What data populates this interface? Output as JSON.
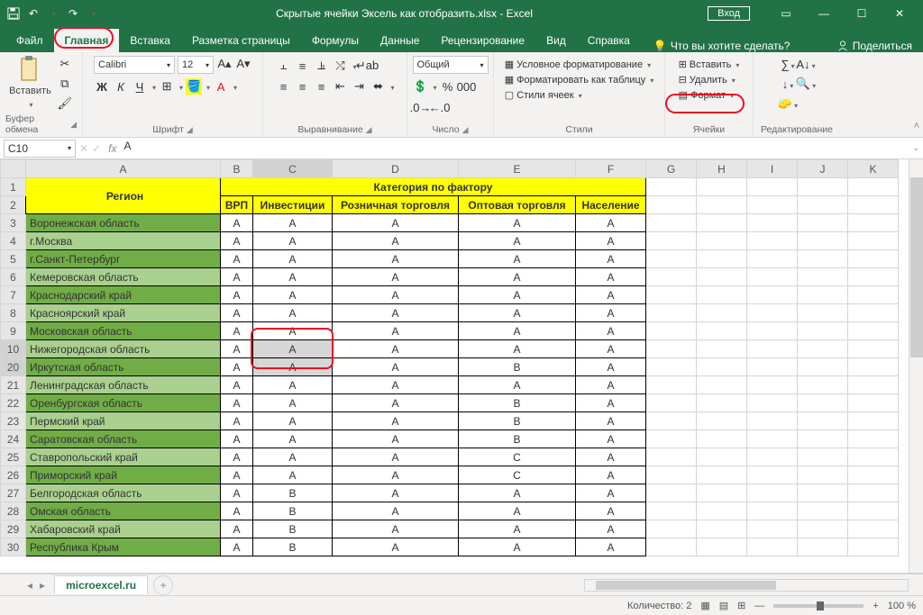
{
  "titlebar": {
    "title": "Скрытые ячейки Эксель как отобразить.xlsx  -  Excel",
    "login": "Вход"
  },
  "tabs": {
    "file": "Файл",
    "home": "Главная",
    "insert": "Вставка",
    "layout": "Разметка страницы",
    "formulas": "Формулы",
    "data": "Данные",
    "review": "Рецензирование",
    "view": "Вид",
    "help": "Справка",
    "tellme": "Что вы хотите сделать?",
    "share": "Поделиться"
  },
  "ribbon": {
    "clipboard": {
      "paste": "Вставить",
      "label": "Буфер обмена"
    },
    "font": {
      "name": "Calibri",
      "size": "12",
      "label": "Шрифт"
    },
    "align": {
      "label": "Выравнивание"
    },
    "number": {
      "format": "Общий",
      "label": "Число"
    },
    "styles": {
      "cond": "Условное форматирование",
      "table": "Форматировать как таблицу",
      "cell": "Стили ячеек",
      "label": "Стили"
    },
    "cells": {
      "insert": "Вставить",
      "delete": "Удалить",
      "format": "Формат",
      "label": "Ячейки"
    },
    "editing": {
      "label": "Редактирование"
    }
  },
  "nameBox": "C10",
  "formula": "А",
  "columns": [
    "A",
    "B",
    "C",
    "D",
    "E",
    "F",
    "G",
    "H",
    "I",
    "J",
    "K"
  ],
  "header1": {
    "region": "Регион",
    "category": "Категория по фактору"
  },
  "header2": {
    "b": "ВРП",
    "c": "Инвестиции",
    "d": "Розничная торговля",
    "e": "Оптовая торговля",
    "f": "Население"
  },
  "rows": [
    {
      "n": "3",
      "a": "Воронежская область",
      "b": "А",
      "c": "А",
      "d": "А",
      "e": "А",
      "f": "А",
      "g": "d"
    },
    {
      "n": "4",
      "a": "г.Москва",
      "b": "А",
      "c": "А",
      "d": "А",
      "e": "А",
      "f": "А",
      "g": "l"
    },
    {
      "n": "5",
      "a": "г.Санкт-Петербург",
      "b": "А",
      "c": "А",
      "d": "А",
      "e": "А",
      "f": "А",
      "g": "d"
    },
    {
      "n": "6",
      "a": "Кемеровская область",
      "b": "А",
      "c": "А",
      "d": "А",
      "e": "А",
      "f": "А",
      "g": "l"
    },
    {
      "n": "7",
      "a": "Краснодарский край",
      "b": "А",
      "c": "А",
      "d": "А",
      "e": "А",
      "f": "А",
      "g": "d"
    },
    {
      "n": "8",
      "a": "Красноярский край",
      "b": "А",
      "c": "А",
      "d": "А",
      "e": "А",
      "f": "А",
      "g": "l"
    },
    {
      "n": "9",
      "a": "Московская область",
      "b": "А",
      "c": "А",
      "d": "А",
      "e": "А",
      "f": "А",
      "g": "d"
    },
    {
      "n": "10",
      "a": "Нижегородская область",
      "b": "А",
      "c": "А",
      "d": "А",
      "e": "А",
      "f": "А",
      "g": "l",
      "sel": true
    },
    {
      "n": "20",
      "a": "Иркутская область",
      "b": "А",
      "c": "А",
      "d": "А",
      "e": "В",
      "f": "А",
      "g": "d",
      "sel": true
    },
    {
      "n": "21",
      "a": "Ленинградская область",
      "b": "А",
      "c": "А",
      "d": "А",
      "e": "А",
      "f": "А",
      "g": "l"
    },
    {
      "n": "22",
      "a": "Оренбургская область",
      "b": "А",
      "c": "А",
      "d": "А",
      "e": "В",
      "f": "А",
      "g": "d"
    },
    {
      "n": "23",
      "a": "Пермский край",
      "b": "А",
      "c": "А",
      "d": "А",
      "e": "В",
      "f": "А",
      "g": "l"
    },
    {
      "n": "24",
      "a": "Саратовская область",
      "b": "А",
      "c": "А",
      "d": "А",
      "e": "В",
      "f": "А",
      "g": "d"
    },
    {
      "n": "25",
      "a": "Ставропольский край",
      "b": "А",
      "c": "А",
      "d": "А",
      "e": "С",
      "f": "А",
      "g": "l"
    },
    {
      "n": "26",
      "a": "Приморский край",
      "b": "А",
      "c": "А",
      "d": "А",
      "e": "С",
      "f": "А",
      "g": "d"
    },
    {
      "n": "27",
      "a": "Белгородская область",
      "b": "А",
      "c": "В",
      "d": "А",
      "e": "А",
      "f": "А",
      "g": "l"
    },
    {
      "n": "28",
      "a": "Омская область",
      "b": "А",
      "c": "В",
      "d": "А",
      "e": "А",
      "f": "А",
      "g": "d"
    },
    {
      "n": "29",
      "a": "Хабаровский край",
      "b": "А",
      "c": "В",
      "d": "А",
      "e": "А",
      "f": "А",
      "g": "l"
    },
    {
      "n": "30",
      "a": "Республика Крым",
      "b": "А",
      "c": "В",
      "d": "А",
      "e": "А",
      "f": "А",
      "g": "d"
    }
  ],
  "sheetTab": "microexcel.ru",
  "status": {
    "count": "Количество: 2",
    "zoom": "100 %"
  }
}
